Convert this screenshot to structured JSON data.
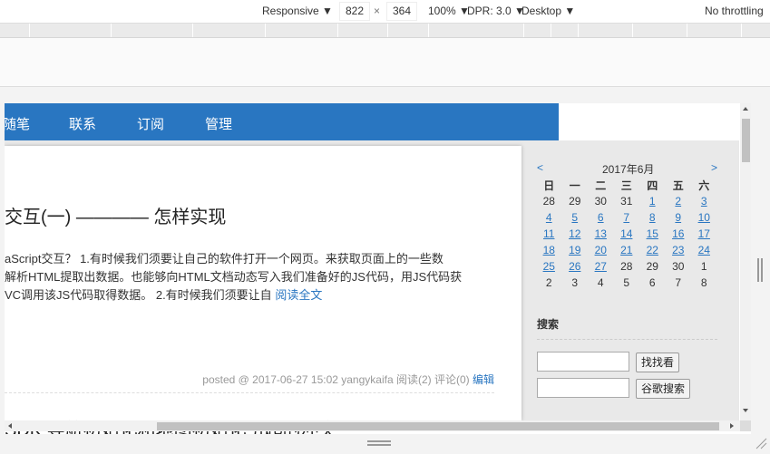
{
  "devtools": {
    "device": "Responsive",
    "width": "822",
    "times": "×",
    "height": "364",
    "zoom": "100%",
    "dpr": "DPR: 3.0",
    "mode": "Desktop",
    "throttling": "No throttling"
  },
  "nav": {
    "items": [
      "随笔",
      "联系",
      "订阅",
      "管理"
    ]
  },
  "post1": {
    "title": "交互(一) ———— 怎样实现",
    "summary_lines": [
      "aScript交互？ 1.有时候我们须要让自己的软件打开一个网页。来获取页面上的一些数",
      "解析HTML提取出数据。也能够向HTML文档动态写入我们准备好的JS代码，用JS代码获",
      "VC调用该JS代码取得数据。 2.有时候我们须要让自"
    ],
    "readmore": "阅读全文",
    "meta": "posted @ 2017-06-27 15:02 yangykaifa 阅读(2) 评论(0)",
    "edit": "编辑"
  },
  "post2": {
    "title": "SDK 导航初始化和地图初始化引起的冲突"
  },
  "calendar": {
    "prev": "<",
    "title": "2017年6月",
    "next": ">",
    "weekdays": [
      "日",
      "一",
      "二",
      "三",
      "四",
      "五",
      "六"
    ],
    "rows": [
      [
        "28",
        "29",
        "30",
        "31",
        "1",
        "2",
        "3"
      ],
      [
        "4",
        "5",
        "6",
        "7",
        "8",
        "9",
        "10"
      ],
      [
        "11",
        "12",
        "13",
        "14",
        "15",
        "16",
        "17"
      ],
      [
        "18",
        "19",
        "20",
        "21",
        "22",
        "23",
        "24"
      ],
      [
        "25",
        "26",
        "27",
        "28",
        "29",
        "30",
        "1"
      ],
      [
        "2",
        "3",
        "4",
        "5",
        "6",
        "7",
        "8"
      ]
    ],
    "linked": [
      [
        false,
        false,
        false,
        false,
        true,
        true,
        true
      ],
      [
        true,
        true,
        true,
        true,
        true,
        true,
        true
      ],
      [
        true,
        true,
        true,
        true,
        true,
        true,
        true
      ],
      [
        true,
        true,
        true,
        true,
        true,
        true,
        true
      ],
      [
        true,
        true,
        true,
        false,
        false,
        false,
        false
      ],
      [
        false,
        false,
        false,
        false,
        false,
        false,
        false
      ]
    ]
  },
  "search": {
    "title": "搜索",
    "button1": "找找看",
    "button2": "谷歌搜索"
  }
}
